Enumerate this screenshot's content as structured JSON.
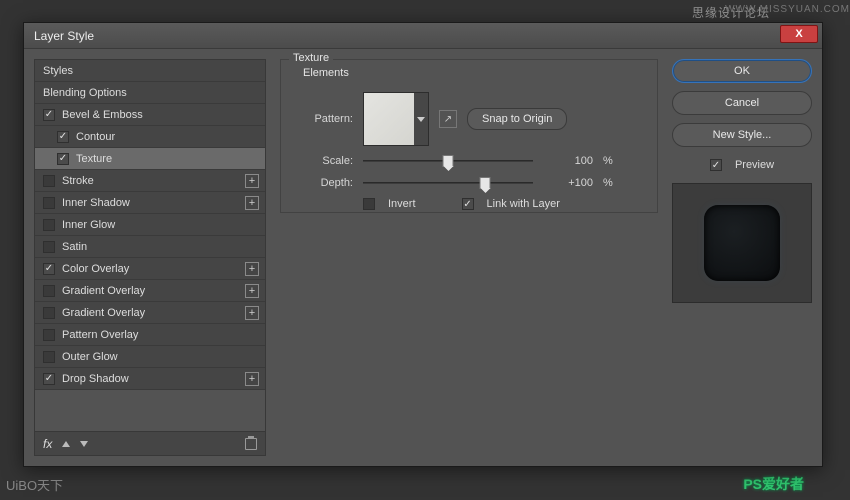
{
  "watermarks": {
    "top": "思缘设计论坛",
    "url": "WWW.MISSYUAN.COM",
    "bottom": "PS爱好者",
    "bottom2": "UiBO天下"
  },
  "dialog": {
    "title": "Layer Style",
    "close": "X"
  },
  "styles": {
    "header": "Styles",
    "blending": "Blending Options",
    "bevel": "Bevel & Emboss",
    "contour": "Contour",
    "texture": "Texture",
    "stroke": "Stroke",
    "innerShadow": "Inner Shadow",
    "innerGlow": "Inner Glow",
    "satin": "Satin",
    "colorOverlay": "Color Overlay",
    "gradientOverlay1": "Gradient Overlay",
    "gradientOverlay2": "Gradient Overlay",
    "patternOverlay": "Pattern Overlay",
    "outerGlow": "Outer Glow",
    "dropShadow": "Drop Shadow",
    "fx": "fx"
  },
  "texture": {
    "groupTitle": "Texture",
    "elements": "Elements",
    "patternLabel": "Pattern:",
    "snap": "Snap to Origin",
    "scaleLabel": "Scale:",
    "scaleValue": "100",
    "scalePct": "%",
    "scalePos": 50,
    "depthLabel": "Depth:",
    "depthValue": "+100",
    "depthPct": "%",
    "depthPos": 72,
    "invert": "Invert",
    "linkLayer": "Link with Layer"
  },
  "right": {
    "ok": "OK",
    "cancel": "Cancel",
    "newStyle": "New Style...",
    "preview": "Preview"
  }
}
